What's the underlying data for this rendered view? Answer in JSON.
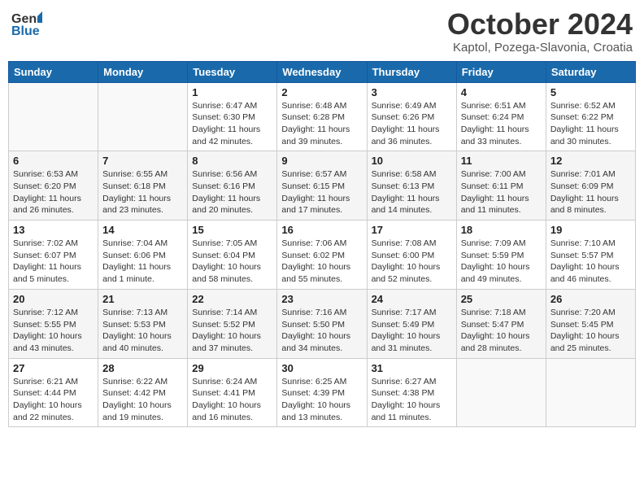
{
  "header": {
    "logo_general": "General",
    "logo_blue": "Blue",
    "month": "October 2024",
    "location": "Kaptol, Pozega-Slavonia, Croatia"
  },
  "days_of_week": [
    "Sunday",
    "Monday",
    "Tuesday",
    "Wednesday",
    "Thursday",
    "Friday",
    "Saturday"
  ],
  "weeks": [
    [
      {
        "day": "",
        "sunrise": "",
        "sunset": "",
        "daylight": ""
      },
      {
        "day": "",
        "sunrise": "",
        "sunset": "",
        "daylight": ""
      },
      {
        "day": "1",
        "sunrise": "Sunrise: 6:47 AM",
        "sunset": "Sunset: 6:30 PM",
        "daylight": "Daylight: 11 hours and 42 minutes."
      },
      {
        "day": "2",
        "sunrise": "Sunrise: 6:48 AM",
        "sunset": "Sunset: 6:28 PM",
        "daylight": "Daylight: 11 hours and 39 minutes."
      },
      {
        "day": "3",
        "sunrise": "Sunrise: 6:49 AM",
        "sunset": "Sunset: 6:26 PM",
        "daylight": "Daylight: 11 hours and 36 minutes."
      },
      {
        "day": "4",
        "sunrise": "Sunrise: 6:51 AM",
        "sunset": "Sunset: 6:24 PM",
        "daylight": "Daylight: 11 hours and 33 minutes."
      },
      {
        "day": "5",
        "sunrise": "Sunrise: 6:52 AM",
        "sunset": "Sunset: 6:22 PM",
        "daylight": "Daylight: 11 hours and 30 minutes."
      }
    ],
    [
      {
        "day": "6",
        "sunrise": "Sunrise: 6:53 AM",
        "sunset": "Sunset: 6:20 PM",
        "daylight": "Daylight: 11 hours and 26 minutes."
      },
      {
        "day": "7",
        "sunrise": "Sunrise: 6:55 AM",
        "sunset": "Sunset: 6:18 PM",
        "daylight": "Daylight: 11 hours and 23 minutes."
      },
      {
        "day": "8",
        "sunrise": "Sunrise: 6:56 AM",
        "sunset": "Sunset: 6:16 PM",
        "daylight": "Daylight: 11 hours and 20 minutes."
      },
      {
        "day": "9",
        "sunrise": "Sunrise: 6:57 AM",
        "sunset": "Sunset: 6:15 PM",
        "daylight": "Daylight: 11 hours and 17 minutes."
      },
      {
        "day": "10",
        "sunrise": "Sunrise: 6:58 AM",
        "sunset": "Sunset: 6:13 PM",
        "daylight": "Daylight: 11 hours and 14 minutes."
      },
      {
        "day": "11",
        "sunrise": "Sunrise: 7:00 AM",
        "sunset": "Sunset: 6:11 PM",
        "daylight": "Daylight: 11 hours and 11 minutes."
      },
      {
        "day": "12",
        "sunrise": "Sunrise: 7:01 AM",
        "sunset": "Sunset: 6:09 PM",
        "daylight": "Daylight: 11 hours and 8 minutes."
      }
    ],
    [
      {
        "day": "13",
        "sunrise": "Sunrise: 7:02 AM",
        "sunset": "Sunset: 6:07 PM",
        "daylight": "Daylight: 11 hours and 5 minutes."
      },
      {
        "day": "14",
        "sunrise": "Sunrise: 7:04 AM",
        "sunset": "Sunset: 6:06 PM",
        "daylight": "Daylight: 11 hours and 1 minute."
      },
      {
        "day": "15",
        "sunrise": "Sunrise: 7:05 AM",
        "sunset": "Sunset: 6:04 PM",
        "daylight": "Daylight: 10 hours and 58 minutes."
      },
      {
        "day": "16",
        "sunrise": "Sunrise: 7:06 AM",
        "sunset": "Sunset: 6:02 PM",
        "daylight": "Daylight: 10 hours and 55 minutes."
      },
      {
        "day": "17",
        "sunrise": "Sunrise: 7:08 AM",
        "sunset": "Sunset: 6:00 PM",
        "daylight": "Daylight: 10 hours and 52 minutes."
      },
      {
        "day": "18",
        "sunrise": "Sunrise: 7:09 AM",
        "sunset": "Sunset: 5:59 PM",
        "daylight": "Daylight: 10 hours and 49 minutes."
      },
      {
        "day": "19",
        "sunrise": "Sunrise: 7:10 AM",
        "sunset": "Sunset: 5:57 PM",
        "daylight": "Daylight: 10 hours and 46 minutes."
      }
    ],
    [
      {
        "day": "20",
        "sunrise": "Sunrise: 7:12 AM",
        "sunset": "Sunset: 5:55 PM",
        "daylight": "Daylight: 10 hours and 43 minutes."
      },
      {
        "day": "21",
        "sunrise": "Sunrise: 7:13 AM",
        "sunset": "Sunset: 5:53 PM",
        "daylight": "Daylight: 10 hours and 40 minutes."
      },
      {
        "day": "22",
        "sunrise": "Sunrise: 7:14 AM",
        "sunset": "Sunset: 5:52 PM",
        "daylight": "Daylight: 10 hours and 37 minutes."
      },
      {
        "day": "23",
        "sunrise": "Sunrise: 7:16 AM",
        "sunset": "Sunset: 5:50 PM",
        "daylight": "Daylight: 10 hours and 34 minutes."
      },
      {
        "day": "24",
        "sunrise": "Sunrise: 7:17 AM",
        "sunset": "Sunset: 5:49 PM",
        "daylight": "Daylight: 10 hours and 31 minutes."
      },
      {
        "day": "25",
        "sunrise": "Sunrise: 7:18 AM",
        "sunset": "Sunset: 5:47 PM",
        "daylight": "Daylight: 10 hours and 28 minutes."
      },
      {
        "day": "26",
        "sunrise": "Sunrise: 7:20 AM",
        "sunset": "Sunset: 5:45 PM",
        "daylight": "Daylight: 10 hours and 25 minutes."
      }
    ],
    [
      {
        "day": "27",
        "sunrise": "Sunrise: 6:21 AM",
        "sunset": "Sunset: 4:44 PM",
        "daylight": "Daylight: 10 hours and 22 minutes."
      },
      {
        "day": "28",
        "sunrise": "Sunrise: 6:22 AM",
        "sunset": "Sunset: 4:42 PM",
        "daylight": "Daylight: 10 hours and 19 minutes."
      },
      {
        "day": "29",
        "sunrise": "Sunrise: 6:24 AM",
        "sunset": "Sunset: 4:41 PM",
        "daylight": "Daylight: 10 hours and 16 minutes."
      },
      {
        "day": "30",
        "sunrise": "Sunrise: 6:25 AM",
        "sunset": "Sunset: 4:39 PM",
        "daylight": "Daylight: 10 hours and 13 minutes."
      },
      {
        "day": "31",
        "sunrise": "Sunrise: 6:27 AM",
        "sunset": "Sunset: 4:38 PM",
        "daylight": "Daylight: 10 hours and 11 minutes."
      },
      {
        "day": "",
        "sunrise": "",
        "sunset": "",
        "daylight": ""
      },
      {
        "day": "",
        "sunrise": "",
        "sunset": "",
        "daylight": ""
      }
    ]
  ]
}
